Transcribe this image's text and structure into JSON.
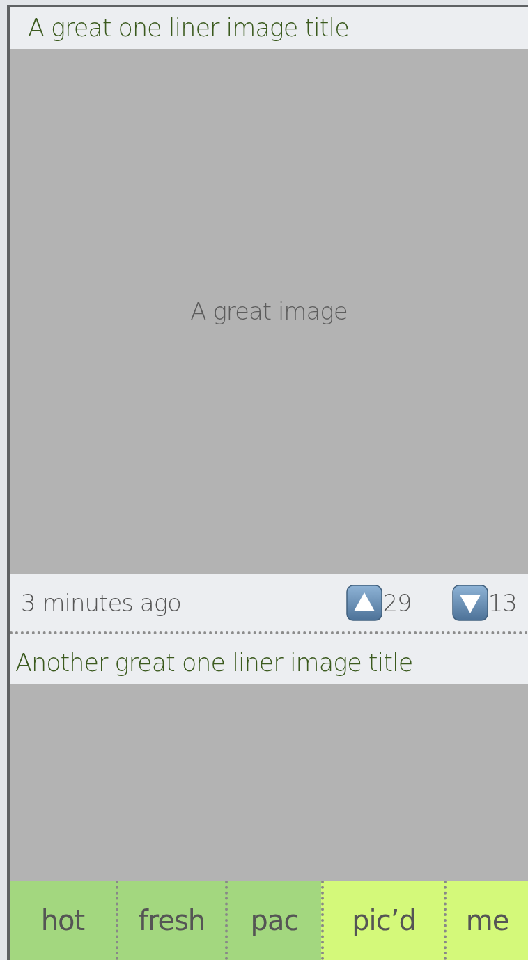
{
  "posts": [
    {
      "title": "A great one liner image title",
      "image_label": "A great image",
      "time": "3 minutes ago",
      "upvotes": "29",
      "downvotes": "13"
    },
    {
      "title": "Another great one liner image title"
    }
  ],
  "tabs": [
    {
      "label": "hot",
      "color": "#a3d77f"
    },
    {
      "label": "fresh",
      "color": "#a3d77f"
    },
    {
      "label": "pac",
      "color": "#a3d77f"
    },
    {
      "label": "pic’d",
      "color": "#d4f97a"
    },
    {
      "label": "me",
      "color": "#d4f97a"
    }
  ]
}
